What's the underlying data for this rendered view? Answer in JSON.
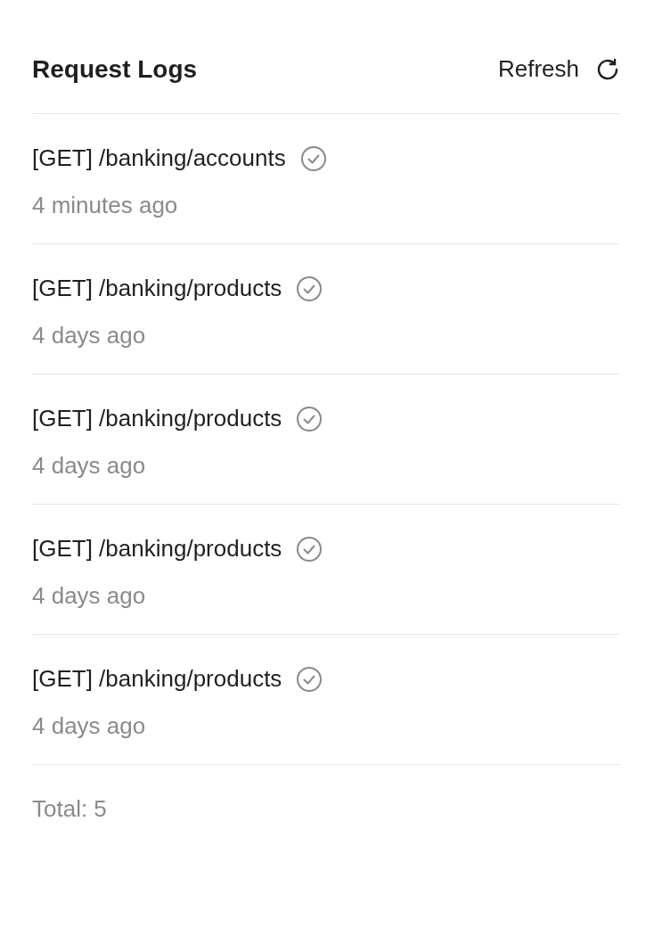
{
  "header": {
    "title": "Request Logs",
    "refresh_label": "Refresh"
  },
  "logs": [
    {
      "request": "[GET] /banking/accounts",
      "success": true,
      "time": "4 minutes ago"
    },
    {
      "request": "[GET] /banking/products",
      "success": true,
      "time": "4 days ago"
    },
    {
      "request": "[GET] /banking/products",
      "success": true,
      "time": "4 days ago"
    },
    {
      "request": "[GET] /banking/products",
      "success": true,
      "time": "4 days ago"
    },
    {
      "request": "[GET] /banking/products",
      "success": true,
      "time": "4 days ago"
    }
  ],
  "footer": {
    "total": "Total: 5"
  }
}
